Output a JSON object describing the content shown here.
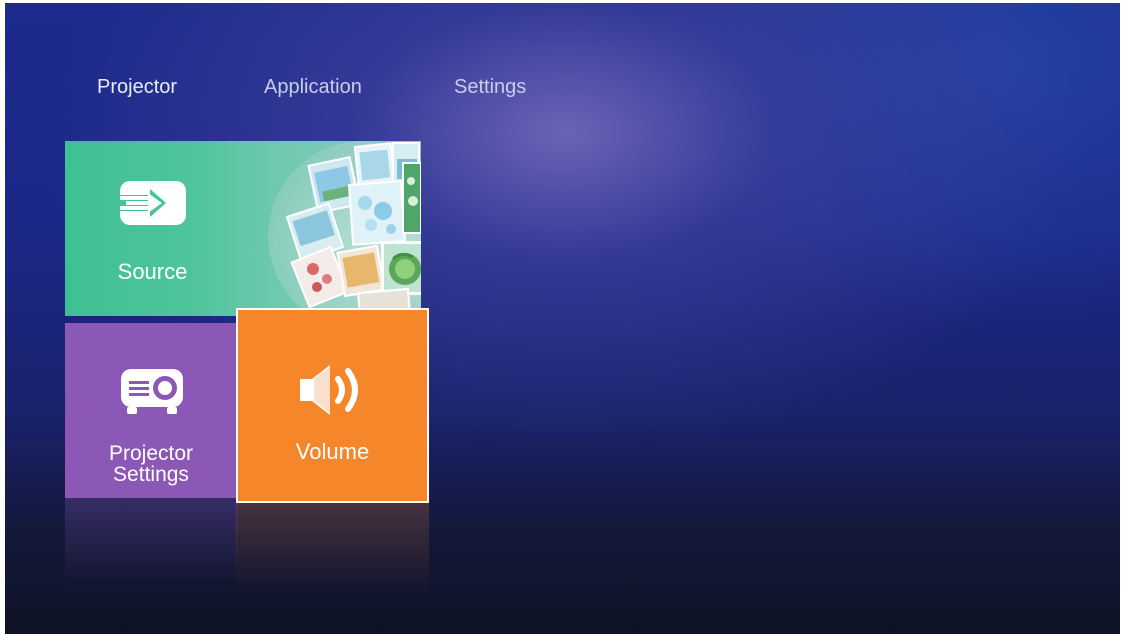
{
  "nav": {
    "tabs": [
      {
        "label": "Projector",
        "active": true
      },
      {
        "label": "Application",
        "active": false
      },
      {
        "label": "Settings",
        "active": false
      }
    ]
  },
  "tiles": {
    "source": {
      "label": "Source",
      "icon": "source-input-icon",
      "color": "#3fbf94"
    },
    "projector_settings": {
      "label_line1": "Projector",
      "label_line2": "Settings",
      "icon": "projector-icon",
      "color": "#8b58b6"
    },
    "volume": {
      "label": "Volume",
      "icon": "speaker-volume-icon",
      "color": "#f6862a",
      "focused": true
    }
  },
  "colors": {
    "background": "#1c2888",
    "tab_highlight": "#3c7cf0",
    "focus_border": "#ffffff"
  }
}
